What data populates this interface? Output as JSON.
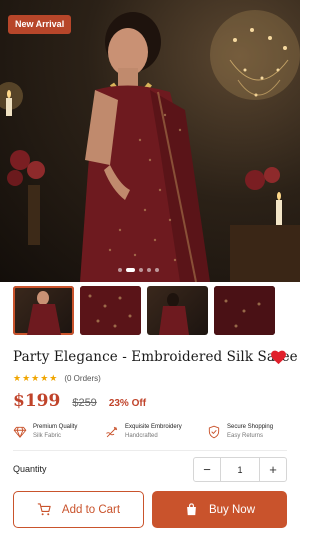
{
  "product": {
    "badge": "New Arrival",
    "title": "Party Elegance - Embroidered Silk Saree",
    "rating_stars": "★★★★★",
    "rating_value": 5,
    "orders": "(0 Orders)",
    "price": "$199",
    "old_price": "$259",
    "discount": "23% Off",
    "favorited": true
  },
  "gallery": {
    "active_index": 0,
    "image_count": 5,
    "thumbnail_count": 4
  },
  "features": [
    {
      "icon": "diamond-icon",
      "title": "Premium Quality",
      "subtitle": "Silk Fabric"
    },
    {
      "icon": "needle-icon",
      "title": "Exquisite Embroidery",
      "subtitle": "Handcrafted"
    },
    {
      "icon": "shield-check-icon",
      "title": "Secure Shopping",
      "subtitle": "Easy Returns"
    }
  ],
  "quantity": {
    "label": "Quantity",
    "minus": "−",
    "value": "1",
    "plus": "+"
  },
  "actions": {
    "add_to_cart": "Add to Cart",
    "buy_now": "Buy Now"
  },
  "colors": {
    "accent": "#c9532c",
    "price": "#c0432a",
    "star": "#f0a500",
    "heart": "#e0202b",
    "saree": "#6e1a1f"
  }
}
